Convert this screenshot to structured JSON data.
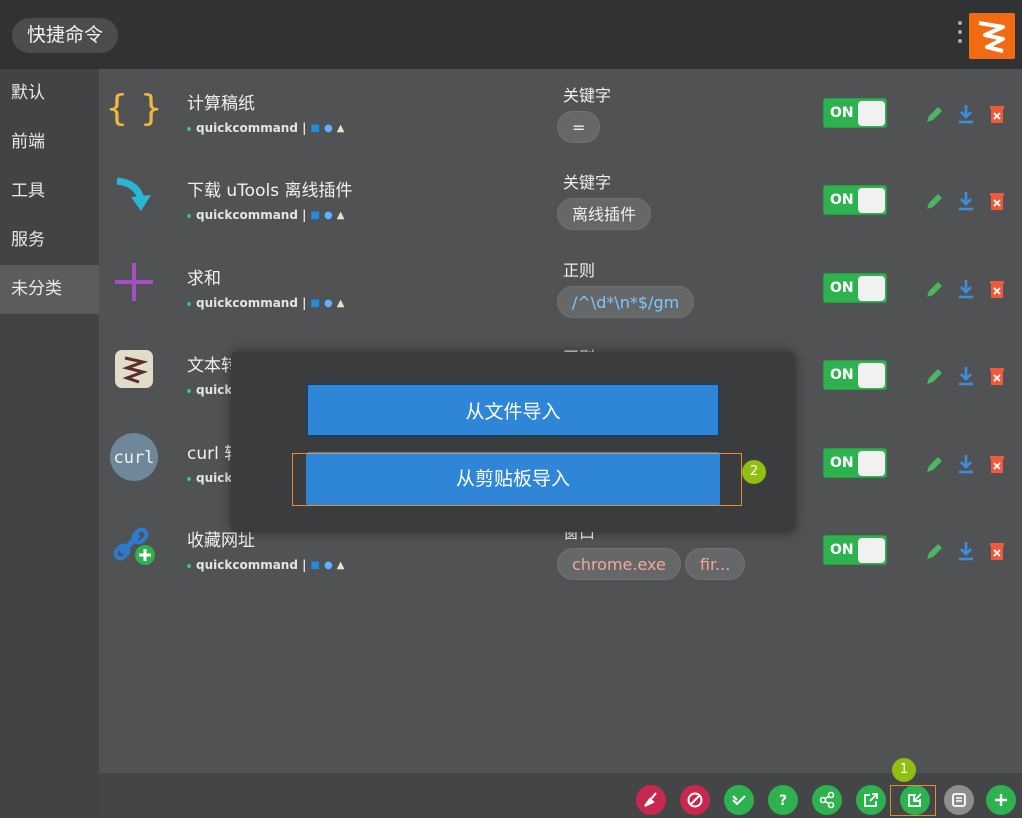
{
  "header": {
    "title": "快捷命令"
  },
  "sidebar": {
    "items": [
      {
        "label": "默认"
      },
      {
        "label": "前端"
      },
      {
        "label": "工具"
      },
      {
        "label": "服务"
      },
      {
        "label": "未分类"
      }
    ]
  },
  "commands": [
    {
      "name": "计算稿纸",
      "author": "quickcommand |",
      "feature_type": "关键字",
      "feature_values": [
        "="
      ],
      "toggle": "ON"
    },
    {
      "name": "下载 uTools 离线插件",
      "author": "quickcommand |",
      "feature_type": "关键字",
      "feature_values": [
        "离线插件"
      ],
      "toggle": "ON"
    },
    {
      "name": "求和",
      "author": "quickcommand |",
      "feature_type": "正则",
      "feature_values": [
        "/^\\d*\\n*$/gm"
      ],
      "toggle": "ON"
    },
    {
      "name": "文本转换",
      "author": "quickcommand |",
      "feature_type": "正则",
      "feature_values": [],
      "toggle": "ON"
    },
    {
      "name": "curl 转换",
      "author": "quickcommand |",
      "feature_type": "",
      "feature_values": [],
      "toggle": "ON"
    },
    {
      "name": "收藏网址",
      "author": "quickcommand |",
      "feature_type": "窗口",
      "feature_values": [
        "chrome.exe",
        "fir..."
      ],
      "toggle": "ON"
    }
  ],
  "icons": {
    "row_icons": [
      "braces-icon",
      "download-arrow-icon",
      "plus-sum-icon",
      "text-convert-icon",
      "curl-icon",
      "link-add-icon"
    ],
    "row_actions": [
      "edit-icon",
      "download-icon",
      "delete-icon"
    ],
    "platforms": [
      "windows-icon",
      "apple-icon",
      "linux-icon"
    ],
    "bottom": [
      "broom-icon",
      "disable-icon",
      "check-all-icon",
      "help-icon",
      "share-icon",
      "export-icon",
      "import-icon",
      "panel-icon",
      "add-icon"
    ]
  },
  "modal": {
    "import_file": "从文件导入",
    "import_clipboard": "从剪贴板导入"
  },
  "markers": {
    "first": "1",
    "second": "2"
  },
  "colors": {
    "accent_blue": "#2f86d6",
    "toggle_green": "#2eb14f",
    "marker_green": "#8fbf10",
    "marker_orange": "#e58a35"
  }
}
